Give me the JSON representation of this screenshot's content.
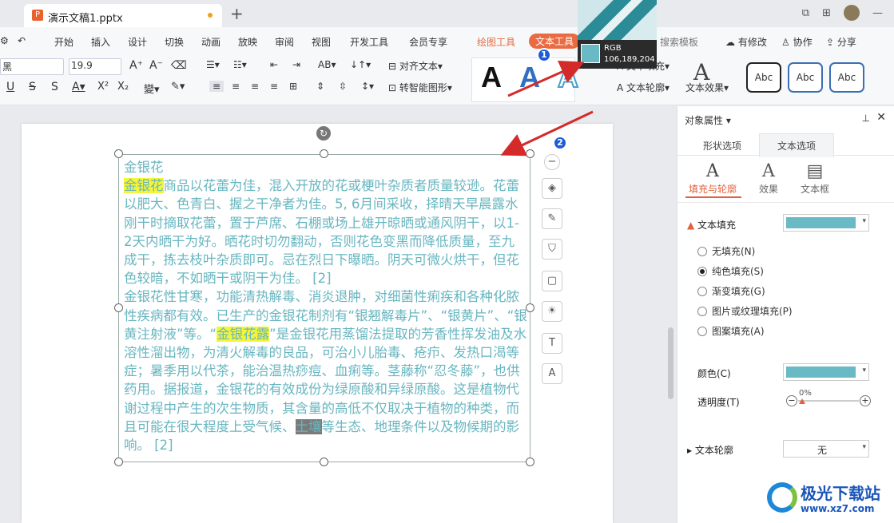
{
  "titlebar": {
    "doc_title": "演示文稿1.pptx",
    "plus": "+"
  },
  "menu": {
    "items": [
      "开始",
      "插入",
      "设计",
      "切换",
      "动画",
      "放映",
      "审阅",
      "视图",
      "开发工具",
      "会员专享",
      "绘图工具",
      "文本工具",
      "搜索模板"
    ],
    "active": "文本工具",
    "right": [
      "有修改",
      "协作",
      "分享"
    ]
  },
  "toolbar": {
    "font": "黑",
    "size": "19.9",
    "align_text": "对齐文本",
    "smart_shape": "转智能图形",
    "text_fill": "文本填充",
    "text_outline": "文本轮廓",
    "text_effect": "文本效果",
    "style_label": "Abc"
  },
  "tooltip": {
    "label": "RGB",
    "value": "106,189,204"
  },
  "badges": [
    "1",
    "2"
  ],
  "slide_text": {
    "line0": "金银花",
    "p1_hl": "金银花",
    "p1_rest": "商品以花蕾为佳，混入开放的花或梗叶杂质者质量较逊。花蕾以肥大、色青白、握之干净者为佳。5, 6月间采收，择晴天早晨露水刚干时摘取花蕾，置于芦席、石棚或场上雄开晾晒或通风阴干，以1-2天内晒干为好。晒花时切勿翻动，否则花色变黑而降低质量，至九成干，拣去枝叶杂质即可。忌在烈日下曝晒。阴天可微火烘干，但花色较暗，不如晒干或阴干为佳。 [2]",
    "p2_a": "金银花性甘寒，功能清热解毒、消炎退肿，对细菌性痢疾和各种化脓性疾病都有效。已生产的金银花制剂有“银翘解毒片”、“银黄片”、“银黄注射液”等。“",
    "p2_hl": "金银花露",
    "p2_b": "”是金银花用蒸馏法提取的芳香性挥发油及水溶性溜出物，为清火解毒的良品，可治小儿胎毒、疮疖、发热口渴等症；暑季用以代茶，能治温热痧痘、血痢等。茎藤称“忍冬藤”，也供药用。据报道，金银花的有效成份为绿原酸和异绿原酸。这是植物代谢过程中产生的次生物质，其含量的高低不仅取决于植物的种类，而且可能在很大程度上受气候、",
    "p2_gr": "土壤",
    "p2_c": "等生态、地理条件以及物候期的影响。 [2]"
  },
  "panel": {
    "title": "对象属性",
    "tabs": [
      "形状选项",
      "文本选项"
    ],
    "subtabs": [
      "填充与轮廓",
      "效果",
      "文本框"
    ],
    "text_fill_label": "文本填充",
    "fill_options": [
      "无填充(N)",
      "纯色填充(S)",
      "渐变填充(G)",
      "图片或纹理填充(P)",
      "图案填充(A)"
    ],
    "selected_fill": "纯色填充(S)",
    "color_label": "颜色(C)",
    "transparency_label": "透明度(T)",
    "transparency_value": "0%",
    "outline_label": "文本轮廓",
    "outline_value": "无",
    "fill_color": "#6abac5"
  },
  "watermark": {
    "cn": "极光下载站",
    "url": "www.xz7.com"
  }
}
